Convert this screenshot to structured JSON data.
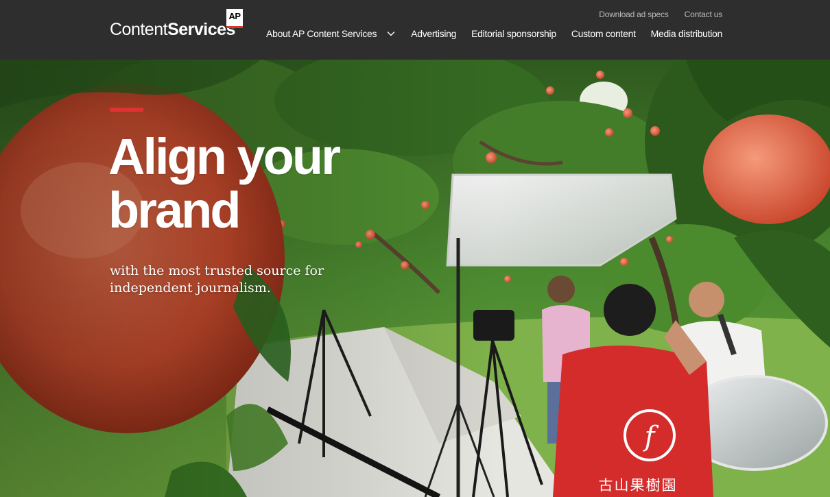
{
  "header": {
    "logo": {
      "word1": "Content",
      "word2": "Services",
      "badge": "AP"
    },
    "utility_nav": [
      "Download ad specs",
      "Contact us"
    ],
    "main_nav": [
      {
        "label": "About AP Content Services",
        "has_dropdown": true
      },
      {
        "label": "Advertising"
      },
      {
        "label": "Editorial sponsorship"
      },
      {
        "label": "Custom content"
      },
      {
        "label": "Media distribution"
      }
    ]
  },
  "hero": {
    "headline": "Align your brand",
    "subhead": "with the most trusted source for independent journalism.",
    "shirt_logo_text": "古山果樹園"
  },
  "colors": {
    "header_bg": "#2e2e2e",
    "accent": "#e0322f",
    "foliage": "#3d6b2a",
    "peach": "#d8583a"
  }
}
